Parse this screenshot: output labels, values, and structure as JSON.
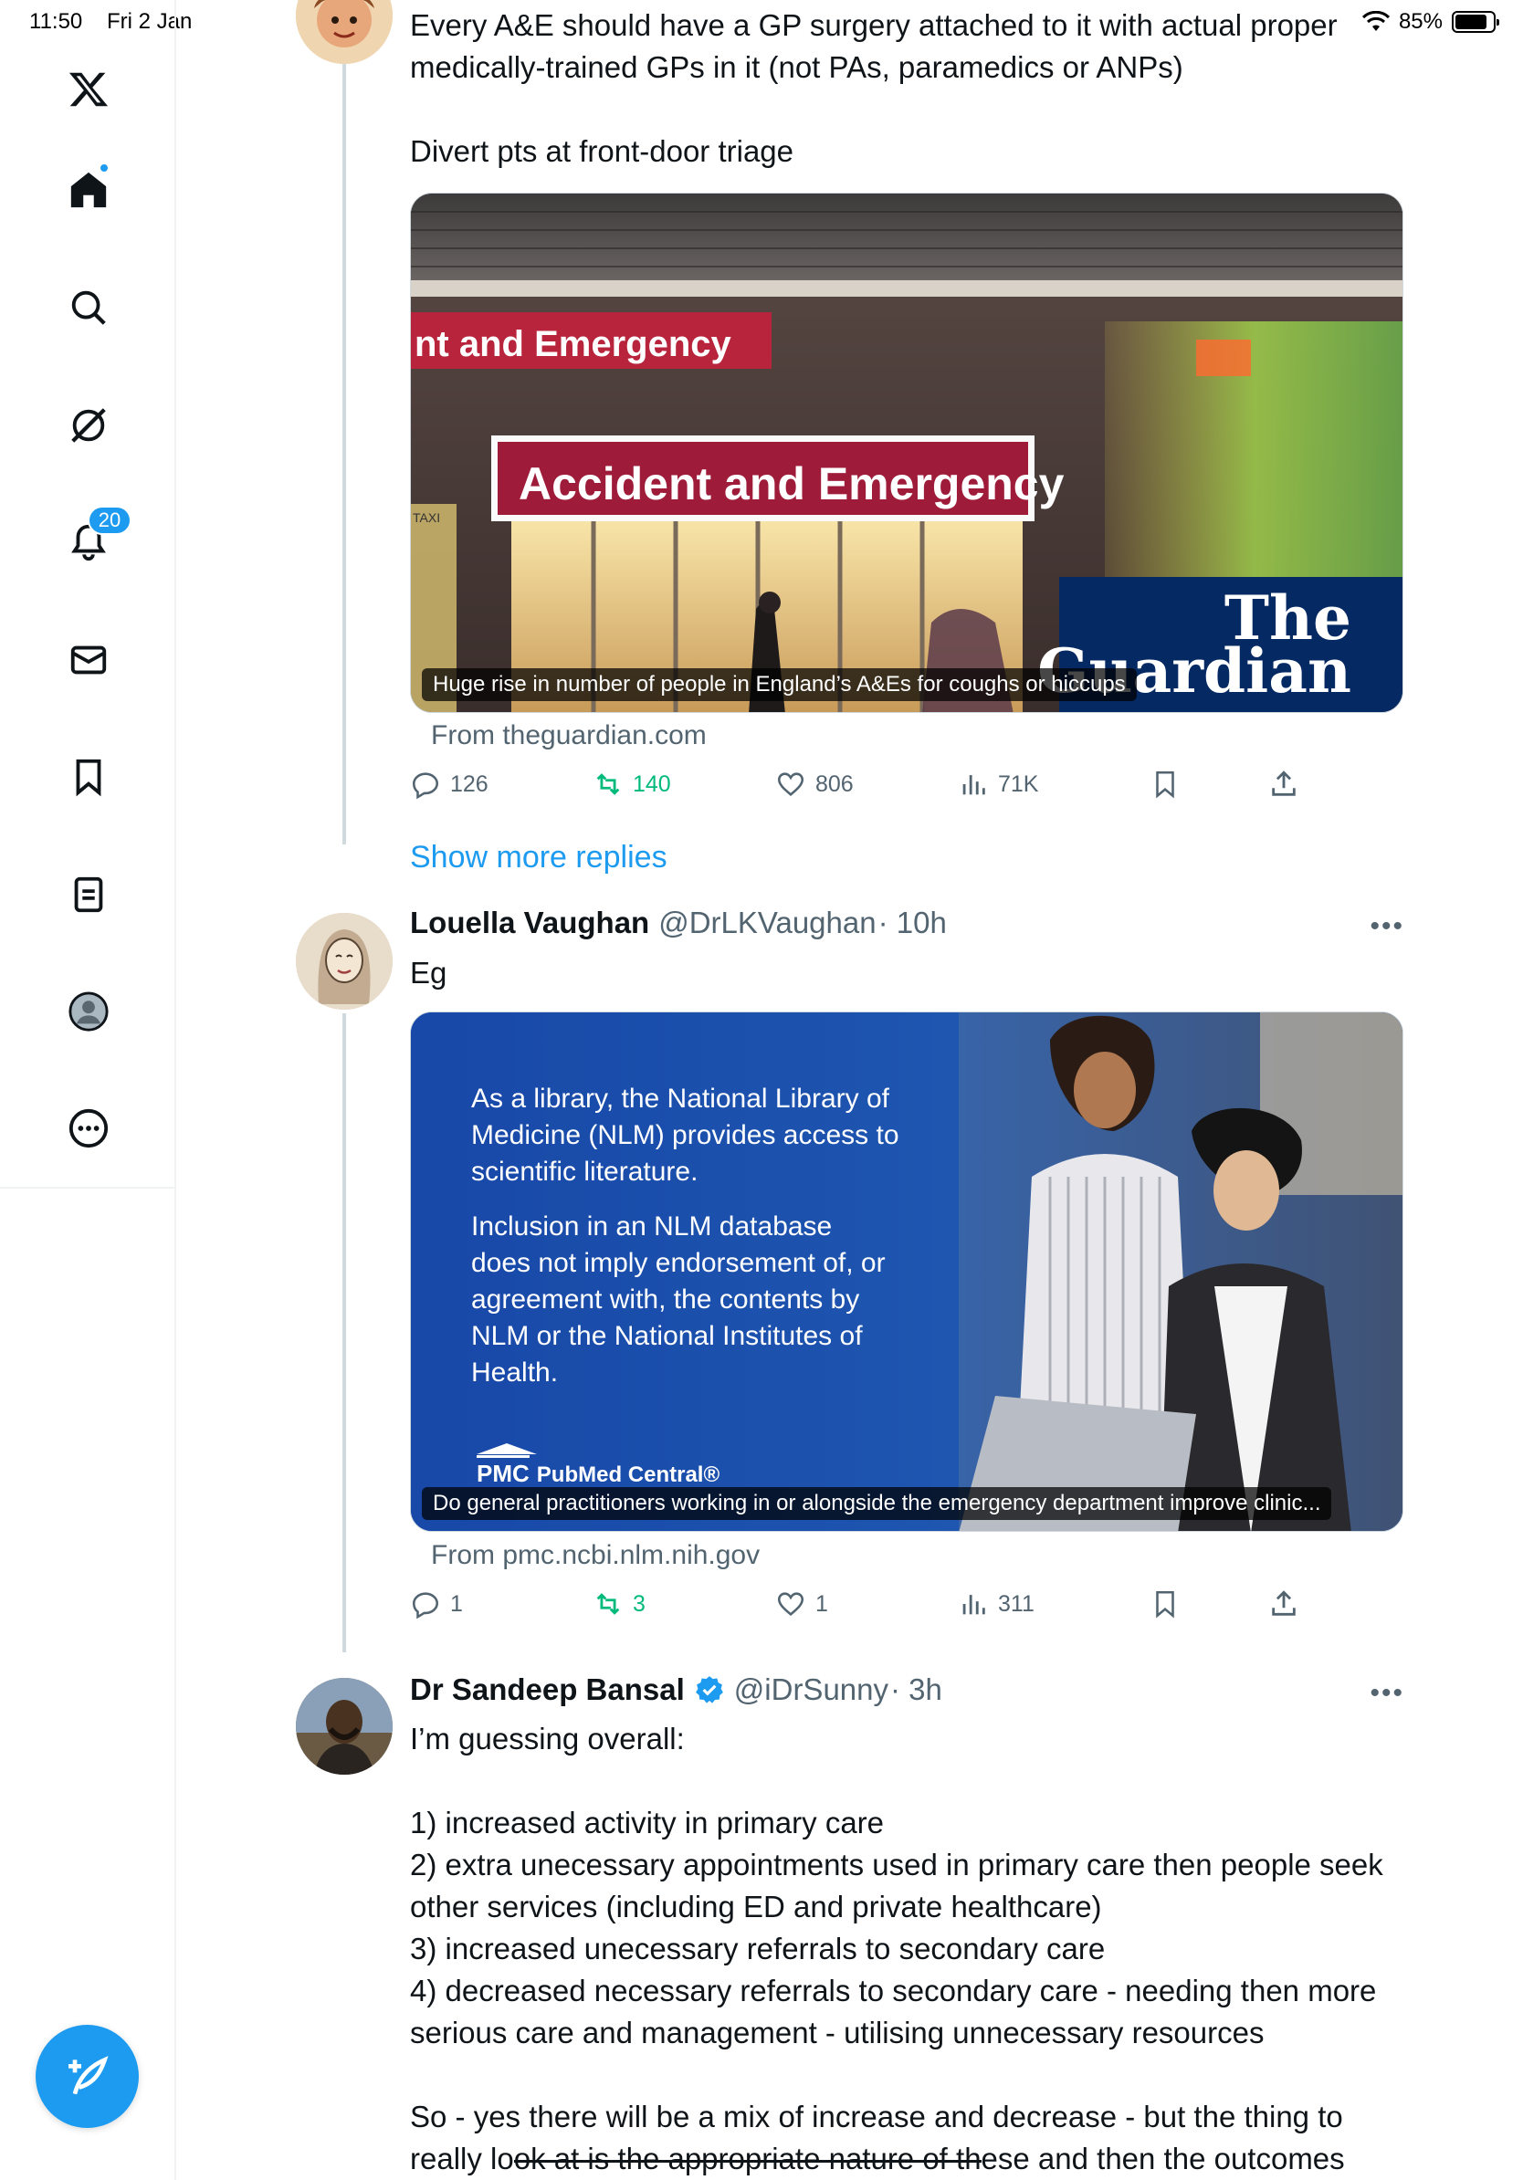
{
  "status_bar": {
    "time": "11:50",
    "date": "Fri 2 Jan",
    "battery": "85%",
    "battery_level": 0.85
  },
  "sidebar": {
    "items": [
      {
        "icon": "x-logo-icon"
      },
      {
        "icon": "home-icon",
        "has_dot": true
      },
      {
        "icon": "search-icon"
      },
      {
        "icon": "grok-icon"
      },
      {
        "icon": "notifications-icon",
        "badge": "20"
      },
      {
        "icon": "mail-icon"
      },
      {
        "icon": "bookmark-icon"
      },
      {
        "icon": "lists-icon"
      },
      {
        "icon": "profile-icon"
      },
      {
        "icon": "more-icon"
      }
    ],
    "compose_icon": "compose-icon"
  },
  "tweet1": {
    "text": "Every A&E should have a GP surgery attached to it with actual proper medically-trained GPs in it (not PAs, paramedics or ANPs)\n\nDivert pts at front-door triage",
    "card": {
      "caption": "Huge rise in number of people in England’s A&Es for coughs or hiccups",
      "source": "From theguardian.com",
      "sign_top": "nt and Emergency",
      "sign_main": "Accident and Emergency",
      "taxi": "TAXI",
      "brand": "The\nGuardian"
    },
    "actions": {
      "replies": "126",
      "retweets": "140",
      "likes": "806",
      "views": "71K"
    }
  },
  "show_more": "Show more replies",
  "tweet2": {
    "name": "Louella Vaughan",
    "handle": "@DrLKVaughan",
    "time": "· 10h",
    "text": "Eg",
    "card": {
      "para1": "As a library, the National Library of Medicine (NLM) provides access to scientific literature.",
      "para2": "Inclusion in an NLM database does not imply endorsement of, or agreement with, the contents by NLM or the National Institutes of Health.",
      "pmc_logo": "PMC",
      "pmc_name": "PubMed Central®",
      "caption": "Do general practitioners working in or alongside the emergency department improve clinic...",
      "source": "From pmc.ncbi.nlm.nih.gov"
    },
    "actions": {
      "replies": "1",
      "retweets": "3",
      "likes": "1",
      "views": "311"
    }
  },
  "tweet3": {
    "name": "Dr Sandeep Bansal",
    "handle": "@iDrSunny",
    "time": "· 3h",
    "text": "I’m guessing overall:\n\n1) increased activity in primary care\n2) extra unecessary appointments used in primary care then people seek other services (including ED and private healthcare)\n3) increased unecessary referrals to secondary care\n4) decreased necessary referrals to secondary care - needing then more serious care and management - utilising unnecessary resources\n\nSo - yes there will be a mix of increase and decrease - but the thing to",
    "last_line_a": "really lo",
    "last_line_strike": "ok at is the appropriate nature of th",
    "last_line_b": "ese and then the outcomes"
  },
  "colors": {
    "accent": "#1d9bf0",
    "retweet": "#00ba7c",
    "text": "#0f1419",
    "muted": "#536471",
    "guardian_bg": "#052962",
    "pmc_bg": "#1a4ba3"
  }
}
